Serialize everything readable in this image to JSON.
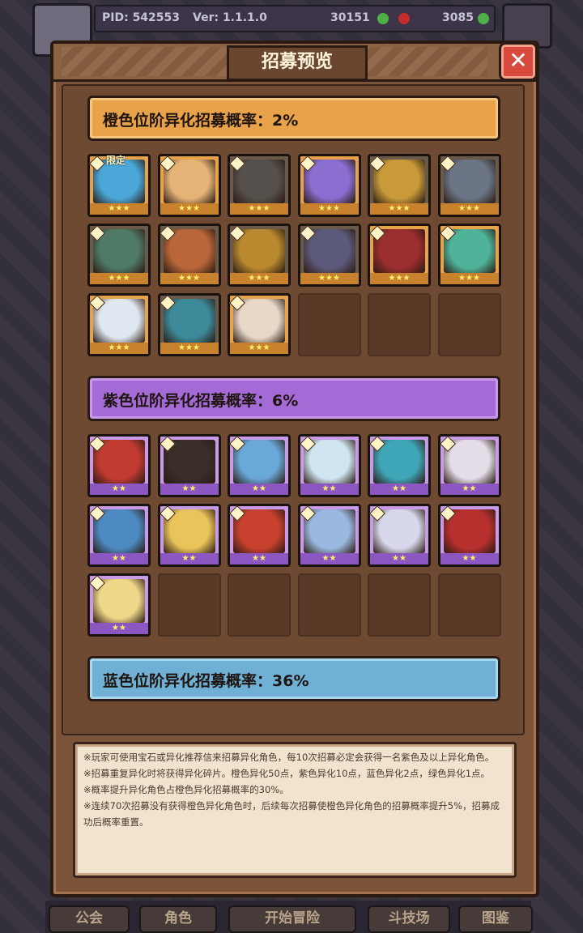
{
  "hud": {
    "pid": "PID: 542553",
    "version": "Ver: 1.1.1.0",
    "currency1": "30151",
    "currency2": "3085"
  },
  "nav": {
    "guild": "公会",
    "character": "角色",
    "adventure": "开始冒险",
    "arena": "斗技场",
    "codex": "图鉴"
  },
  "modal": {
    "title": "招募预览",
    "close": "✕"
  },
  "sections": {
    "orange": {
      "label": "橙色位阶异化招募概率：2%",
      "color": "#e8a24a",
      "cards": [
        {
          "stars": "★★★",
          "badge": "限定",
          "limited": true,
          "hue": "#4aa7d8"
        },
        {
          "stars": "★★★",
          "hue": "#e6b377"
        },
        {
          "stars": "★★★",
          "dim": true,
          "hue": "#55504b"
        },
        {
          "stars": "★★★",
          "hue": "#8a6ed0"
        },
        {
          "stars": "★★★",
          "dim": true,
          "hue": "#c89a3a"
        },
        {
          "stars": "★★★",
          "dim": true,
          "hue": "#6b7586"
        },
        {
          "stars": "★★★",
          "dim": true,
          "hue": "#4e7a66"
        },
        {
          "stars": "★★★",
          "dim": true,
          "hue": "#b9673a"
        },
        {
          "stars": "★★★",
          "dim": true,
          "hue": "#b8892e"
        },
        {
          "stars": "★★★",
          "dim": true,
          "hue": "#5c5a7a"
        },
        {
          "stars": "★★★",
          "hue": "#9b2e2e"
        },
        {
          "stars": "★★★",
          "hue": "#4fb39a"
        },
        {
          "stars": "★★★",
          "hue": "#dfe7f0"
        },
        {
          "stars": "★★★",
          "dim": true,
          "hue": "#3c8a9a"
        },
        {
          "stars": "★★★",
          "hue": "#e9d8c8"
        }
      ]
    },
    "purple": {
      "label": "紫色位阶异化招募概率：6%",
      "color": "#a46bd6",
      "cards": [
        {
          "stars": "★★",
          "hue": "#c23b32"
        },
        {
          "stars": "★★",
          "hue": "#3a2e2a"
        },
        {
          "stars": "★★",
          "hue": "#6aa8d8"
        },
        {
          "stars": "★★",
          "hue": "#cfe6f2"
        },
        {
          "stars": "★★",
          "hue": "#3fa6b8"
        },
        {
          "stars": "★★",
          "hue": "#e4dde8"
        },
        {
          "stars": "★★",
          "hue": "#4e8ac2"
        },
        {
          "stars": "★★",
          "hue": "#e8c45a"
        },
        {
          "stars": "★★",
          "hue": "#c8412e"
        },
        {
          "stars": "★★",
          "hue": "#9ab8e0"
        },
        {
          "stars": "★★",
          "hue": "#d8d8ec"
        },
        {
          "stars": "★★",
          "hue": "#b8302e"
        },
        {
          "stars": "★★",
          "hue": "#f0d88a"
        }
      ]
    },
    "blue": {
      "label": "蓝色位阶异化招募概率：36%",
      "color": "#6fb0d4"
    }
  },
  "notes": [
    "※玩家可使用宝石或异化推荐信来招募异化角色，每10次招募必定会获得一名紫色及以上异化角色。",
    "※招募重复异化时将获得异化碎片。橙色异化50点，紫色异化10点，蓝色异化2点，绿色异化1点。",
    "※概率提升异化角色占橙色异化招募概率的30%。",
    "※连续70次招募没有获得橙色异化角色时，后续每次招募使橙色异化角色的招募概率提升5%，招募成功后概率重置。"
  ]
}
